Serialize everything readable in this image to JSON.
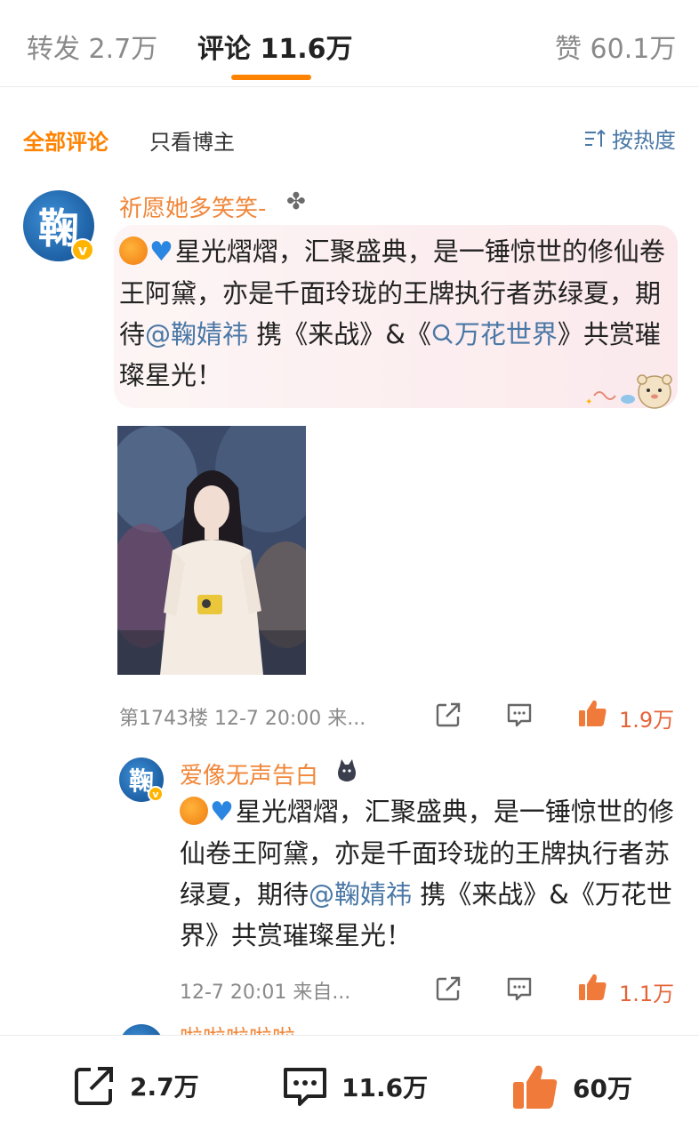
{
  "tabs": {
    "repost": "转发 2.7万",
    "comments": "评论 11.6万",
    "likes": "赞 60.1万"
  },
  "filters": {
    "all": "全部评论",
    "owner_only": "只看博主",
    "sort": "按热度"
  },
  "comment": {
    "username": "祈愿她多笑笑-",
    "avatar_text": "鞠",
    "text_before": "星光熠熠，汇聚盛典，是一锤惊世的修仙卷王阿黛，亦是千面玲珑的王牌执行者苏绿夏，期待",
    "mention": "@鞠婧祎",
    "text_mid": " 携《来战》&《",
    "link": "万花世界",
    "text_after": "》共赏璀璨星光！",
    "meta": "第1743楼 12-7 20:00 来...",
    "likes": "1.9万"
  },
  "reply": {
    "username": "爱像无声告白",
    "avatar_text": "鞠",
    "text_before": "星光熠熠，汇聚盛典，是一锤惊世的修仙卷王阿黛，亦是千面玲珑的王牌执行者苏绿夏，期待",
    "mention": "@鞠婧祎",
    "text_after": " 携《来战》&《万花世界》共赏璀璨星光！",
    "meta": "12-7 20:01 来自...",
    "likes": "1.1万"
  },
  "next_user": {
    "username": "啦啦啦啦啦"
  },
  "bottom": {
    "repost": "2.7万",
    "comments": "11.6万",
    "likes": "60万"
  },
  "colors": {
    "accent": "#ff8200",
    "username": "#f0873a",
    "link": "#4a78a6",
    "like": "#e5653a"
  }
}
